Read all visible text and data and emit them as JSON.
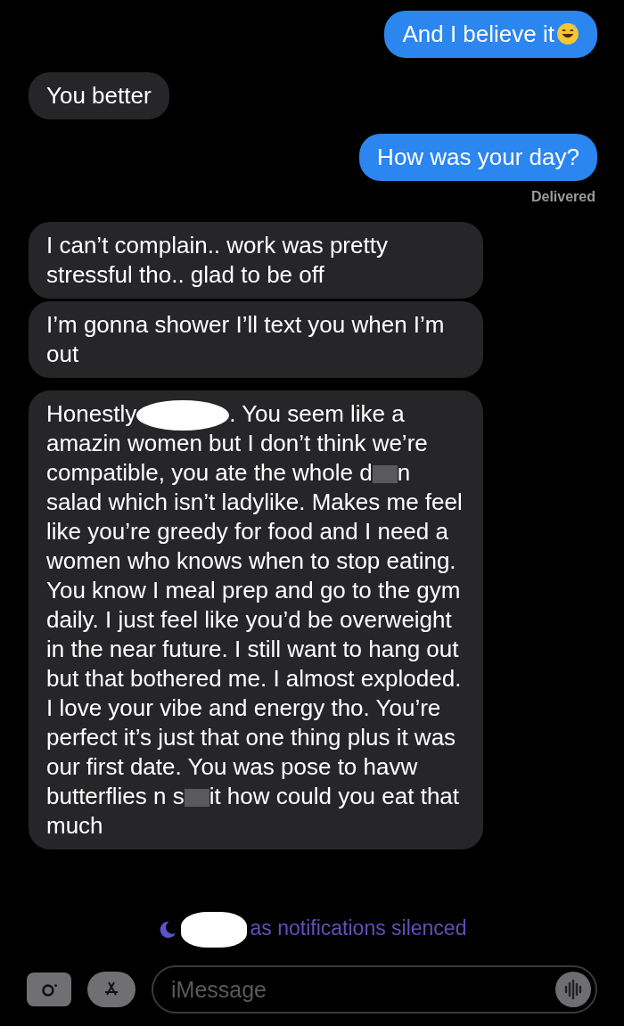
{
  "messages": [
    {
      "kind": "sent",
      "segments": [
        {
          "kind": "text",
          "text": "And I believe it"
        },
        {
          "kind": "emoji"
        }
      ]
    },
    {
      "kind": "received",
      "segments": [
        {
          "kind": "text",
          "text": "You better"
        }
      ]
    },
    {
      "kind": "sent",
      "segments": [
        {
          "kind": "text",
          "text": "How was your day?"
        }
      ],
      "status": "Delivered"
    },
    {
      "kind": "received",
      "segments": [
        {
          "kind": "text",
          "text": "I can’t complain.. work was pretty stressful tho.. glad to be off"
        }
      ]
    },
    {
      "kind": "received",
      "segments": [
        {
          "kind": "text",
          "text": "I’m gonna shower I’ll text you when I’m out"
        }
      ]
    },
    {
      "kind": "received",
      "segments": [
        {
          "kind": "text",
          "text": "Honestly"
        },
        {
          "kind": "blob"
        },
        {
          "kind": "text",
          "text": ". You seem like a amazin women but I don’t think we’re compatible, you ate the whole d"
        },
        {
          "kind": "blur"
        },
        {
          "kind": "text",
          "text": "n salad which isn’t ladylike. Makes me feel like you’re greedy for food and I need a women who knows when to stop eating. You know I meal prep and go to the gym daily. I just feel like you’d be overweight in the near future. I still want to hang out but that bothered me. I almost exploded. I love your vibe and energy tho. You’re perfect it’s just that one thing plus it was our first date. You was pose to havw butterflies n s"
        },
        {
          "kind": "blur"
        },
        {
          "kind": "text",
          "text": "it how could you eat that much"
        }
      ]
    }
  ],
  "notice": {
    "text": "as notifications silenced"
  },
  "composer": {
    "placeholder": "iMessage"
  }
}
